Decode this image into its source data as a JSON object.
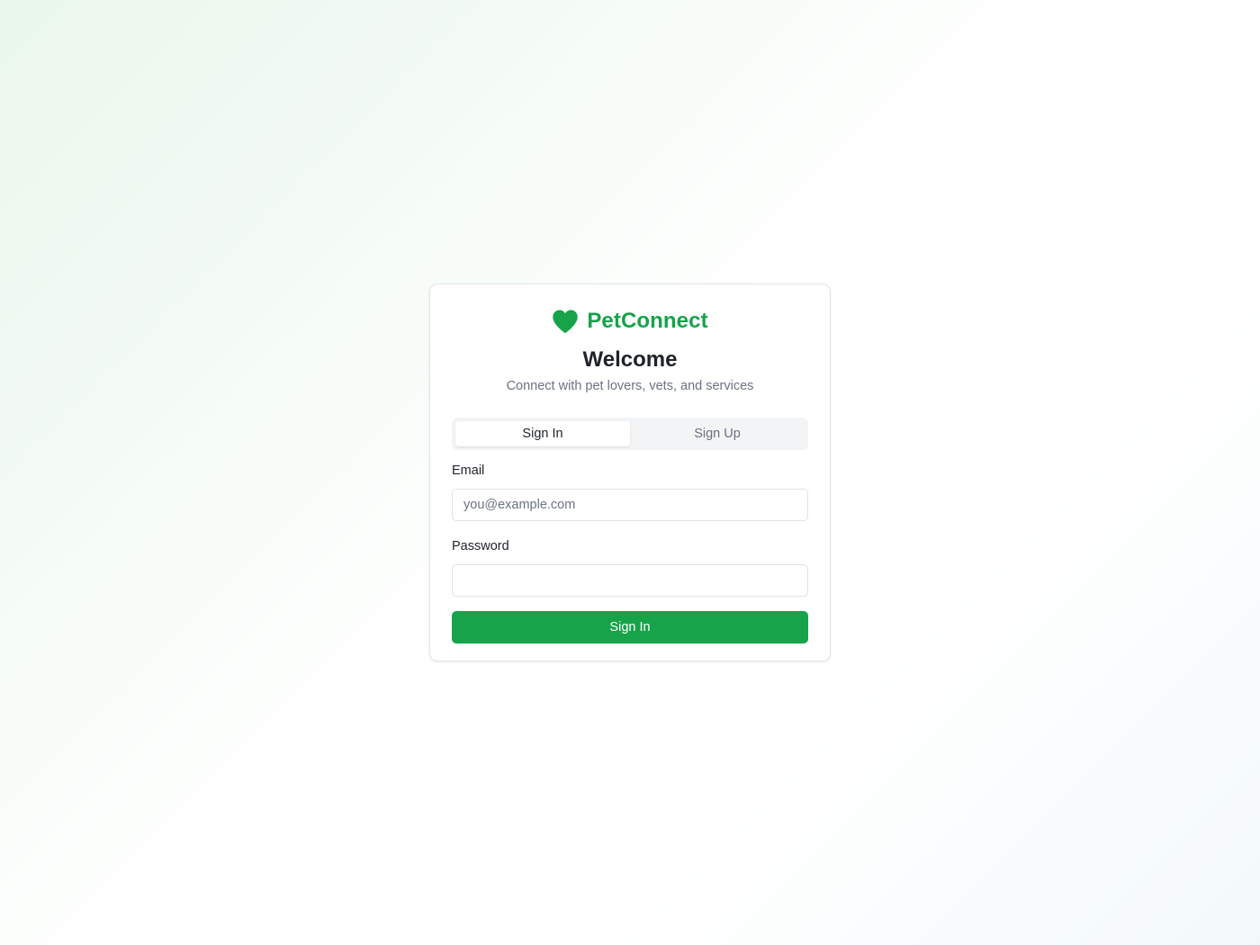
{
  "colors": {
    "brand": "#16a34a",
    "button_bg": "#16a34a"
  },
  "brand": {
    "icon": "heart-icon",
    "name": "PetConnect"
  },
  "header": {
    "title": "Welcome",
    "subtitle": "Connect with pet lovers, vets, and services"
  },
  "tabs": [
    {
      "label": "Sign In",
      "active": true
    },
    {
      "label": "Sign Up",
      "active": false
    }
  ],
  "form": {
    "email_label": "Email",
    "email_placeholder": "you@example.com",
    "email_value": "",
    "password_label": "Password",
    "password_value": "",
    "submit_label": "Sign In"
  }
}
